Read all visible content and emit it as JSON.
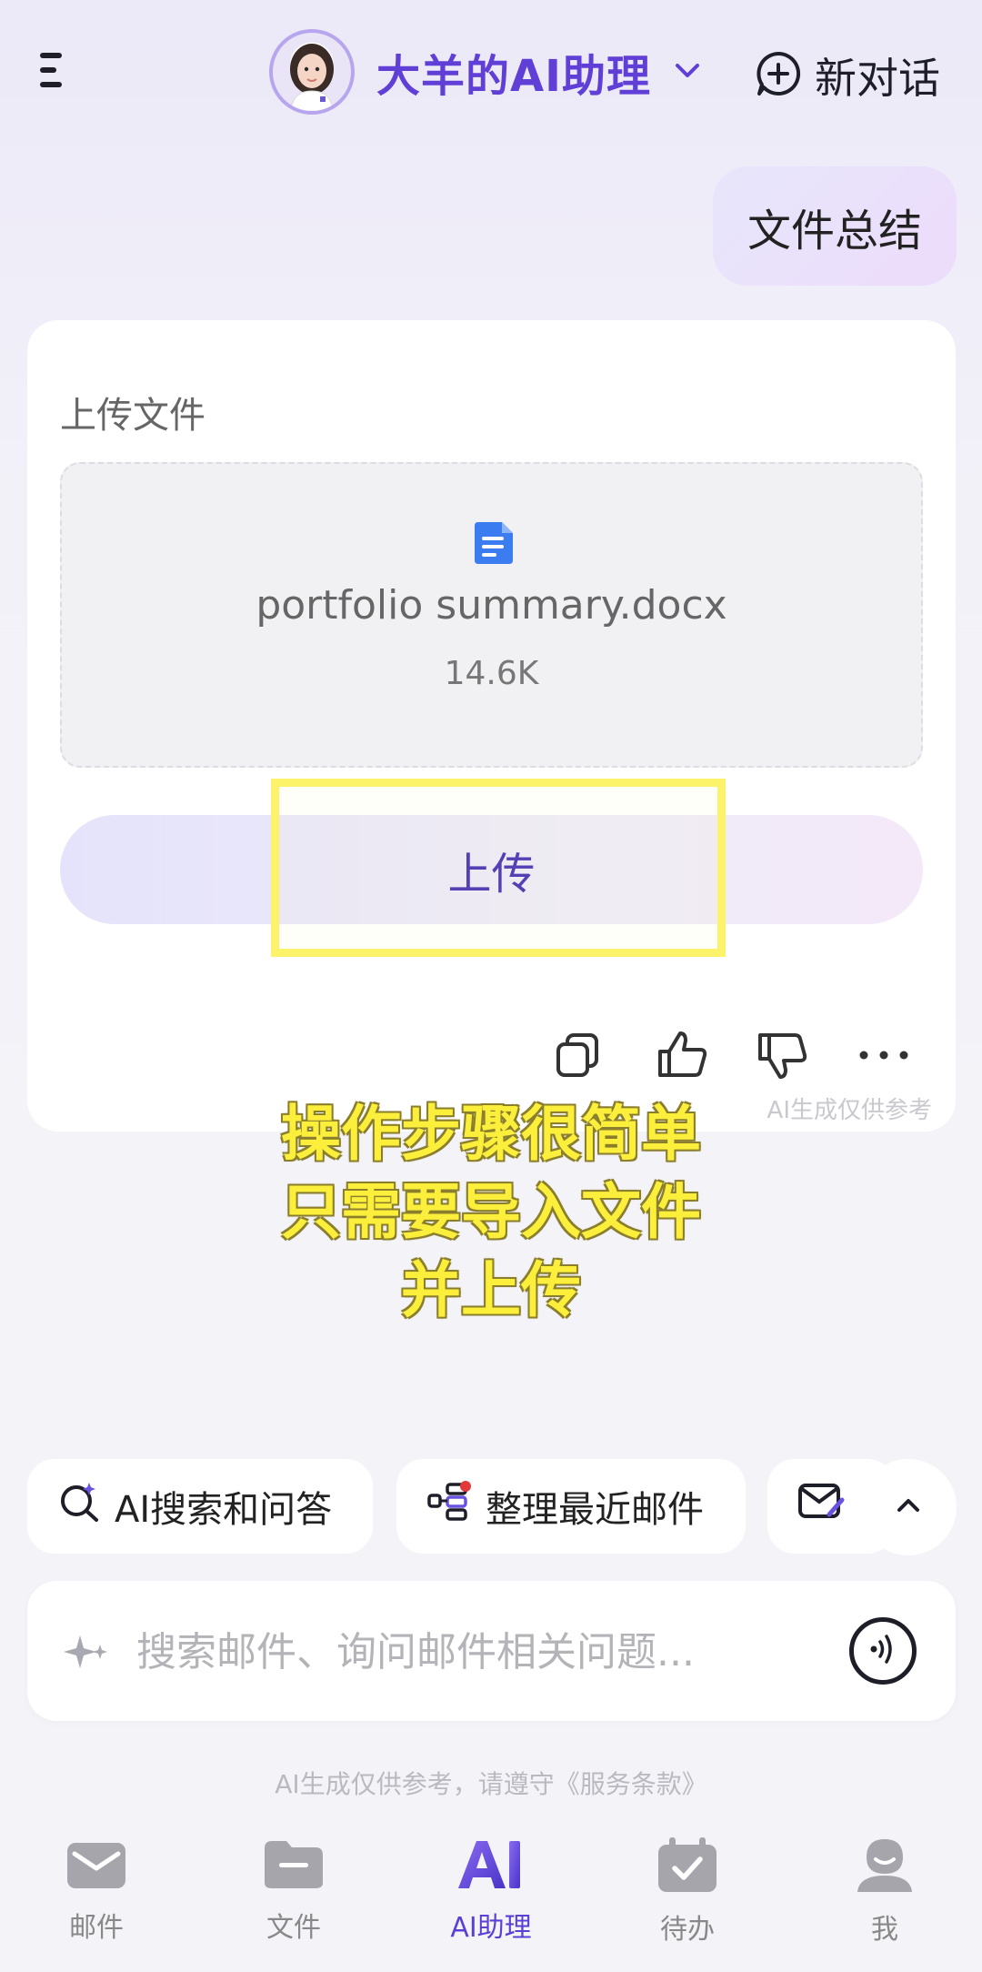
{
  "header": {
    "title": "大羊的AI助理",
    "new_chat_label": "新对话"
  },
  "chat": {
    "user_message": "文件总结"
  },
  "upload_card": {
    "label": "上传文件",
    "file_name": "portfolio summary.docx",
    "file_size": "14.6K",
    "upload_button": "上传",
    "disclaimer": "AI生成仅供参考"
  },
  "overlay_caption": {
    "line1": "操作步骤很简单",
    "line2": "只需要导入文件",
    "line3": "并上传"
  },
  "chips": [
    {
      "label": "AI搜索和问答",
      "icon": "search-sparkle-icon"
    },
    {
      "label": "整理最近邮件",
      "icon": "organize-mail-icon"
    },
    {
      "label": "",
      "icon": "compose-mail-icon"
    }
  ],
  "input": {
    "placeholder": "搜索邮件、询问邮件相关问题..."
  },
  "footer_note": "AI生成仅供参考，请遵守《服务条款》",
  "nav": {
    "items": [
      {
        "label": "邮件",
        "icon": "mail-icon"
      },
      {
        "label": "文件",
        "icon": "folder-icon"
      },
      {
        "label": "AI助理",
        "icon": "ai-icon"
      },
      {
        "label": "待办",
        "icon": "calendar-check-icon"
      },
      {
        "label": "我",
        "icon": "profile-icon"
      }
    ],
    "active_index": 2
  },
  "colors": {
    "accent": "#5f3fd6",
    "highlight": "#fdf36b",
    "caption": "#fbef3b"
  }
}
